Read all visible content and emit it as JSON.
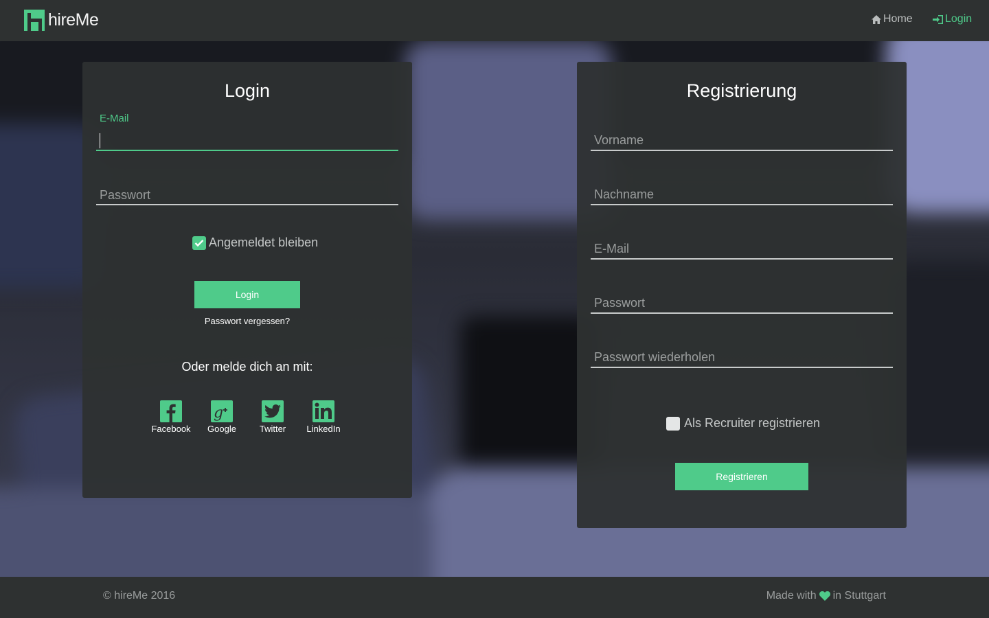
{
  "brand": {
    "name": "hireMe",
    "logo_icon": "hireme-logo-icon",
    "accent": "#4fcb8a"
  },
  "nav": {
    "home": {
      "label": "Home",
      "icon": "home-icon"
    },
    "login": {
      "label": "Login",
      "icon": "sign-in-icon"
    }
  },
  "login": {
    "title": "Login",
    "email_label": "E-Mail",
    "email_value": "",
    "password_label": "Passwort",
    "remember_label": "Angemeldet bleiben",
    "remember_checked": true,
    "submit_label": "Login",
    "forgot_label": "Passwort vergessen?",
    "alt_title": "Oder melde dich an mit:",
    "social": [
      {
        "label": "Facebook",
        "icon": "facebook-icon"
      },
      {
        "label": "Google",
        "icon": "google-plus-icon"
      },
      {
        "label": "Twitter",
        "icon": "twitter-icon"
      },
      {
        "label": "LinkedIn",
        "icon": "linkedin-icon"
      }
    ]
  },
  "register": {
    "title": "Registrierung",
    "fields": [
      {
        "label": "Vorname"
      },
      {
        "label": "Nachname"
      },
      {
        "label": "E-Mail"
      },
      {
        "label": "Passwort"
      },
      {
        "label": "Passwort wiederholen"
      }
    ],
    "recruiter_label": "Als Recruiter registrieren",
    "recruiter_checked": false,
    "submit_label": "Registrieren"
  },
  "footer": {
    "copyright": "© hireMe 2016",
    "made_with_prefix": "Made with",
    "made_with_suffix": "in Stuttgart",
    "heart_icon": "heart-icon"
  }
}
